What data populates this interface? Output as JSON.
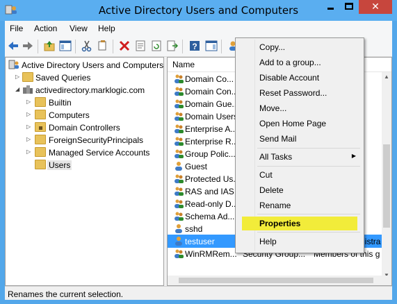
{
  "window": {
    "title": "Active Directory Users and Computers",
    "close_glyph": "✕"
  },
  "menubar": [
    "File",
    "Action",
    "View",
    "Help"
  ],
  "toolbar": {
    "icons": [
      "back-arrow-icon",
      "forward-arrow-icon",
      "up-folder-icon",
      "show-console-tree-icon",
      "cut-icon",
      "copy-icon",
      "delete-icon",
      "properties-icon",
      "refresh-icon",
      "export-list-icon",
      "help-icon",
      "show-action-pane-icon",
      "new-user-icon"
    ]
  },
  "tree": {
    "root": "Active Directory Users and Computers",
    "items": [
      {
        "label": "Saved Queries"
      },
      {
        "label": "activedirectory.marklogic.com"
      },
      {
        "label": "Builtin"
      },
      {
        "label": "Computers"
      },
      {
        "label": "Domain Controllers"
      },
      {
        "label": "ForeignSecurityPrincipals"
      },
      {
        "label": "Managed Service Accounts"
      },
      {
        "label": "Users"
      }
    ]
  },
  "list": {
    "columns": [
      "Name",
      "Type",
      "Description"
    ],
    "rows": [
      {
        "name": "Domain Co...",
        "type": "",
        "desc": "ns an"
      },
      {
        "name": "Domain Con...",
        "type": "",
        "desc": "ntro"
      },
      {
        "name": "Domain Gue...",
        "type": "",
        "desc": "uests"
      },
      {
        "name": "Domain Users",
        "type": "",
        "desc": "users"
      },
      {
        "name": "Enterprise A...",
        "type": "",
        "desc": "dmin"
      },
      {
        "name": "Enterprise R...",
        "type": "",
        "desc": "his g"
      },
      {
        "name": "Group Polic...",
        "type": "",
        "desc": "his g"
      },
      {
        "name": "Guest",
        "type": "",
        "desc": "ccou"
      },
      {
        "name": "Protected Us...",
        "type": "",
        "desc": "his g"
      },
      {
        "name": "RAS and IAS ...",
        "type": "",
        "desc": "his g"
      },
      {
        "name": "Read-only D...",
        "type": "",
        "desc": "his g"
      },
      {
        "name": "Schema Ad...",
        "type": "",
        "desc": "dmin"
      },
      {
        "name": "sshd",
        "type": "",
        "desc": ""
      },
      {
        "name": "testuser",
        "type": "User",
        "desc": "A Test (Administra"
      },
      {
        "name": "WinRMRem...",
        "type": "Security Group...",
        "desc": "Members of this g"
      }
    ]
  },
  "context_menu": {
    "items": [
      {
        "label": "Copy..."
      },
      {
        "label": "Add to a group..."
      },
      {
        "label": "Disable Account"
      },
      {
        "label": "Reset Password..."
      },
      {
        "label": "Move..."
      },
      {
        "label": "Open Home Page"
      },
      {
        "label": "Send Mail"
      },
      {
        "label": "All Tasks",
        "submenu_glyph": "▶"
      },
      {
        "label": "Cut"
      },
      {
        "label": "Delete"
      },
      {
        "label": "Rename"
      },
      {
        "label": "Properties"
      },
      {
        "label": "Help"
      }
    ]
  },
  "status": {
    "text": "Renames the current selection."
  },
  "colors": {
    "titlebar": "#5aaef0",
    "close_button": "#c7463d",
    "selection": "#3399ff",
    "menu_highlight": "#f2ec3a"
  }
}
